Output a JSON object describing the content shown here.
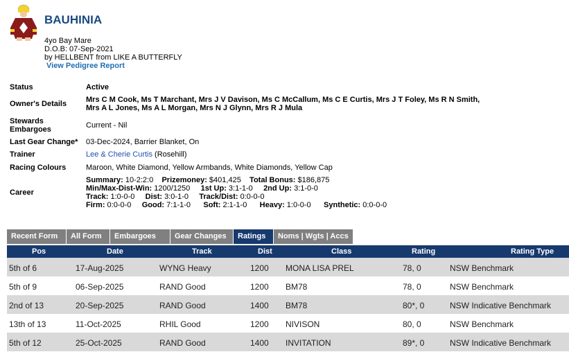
{
  "horse": {
    "name": "BAUHINIA",
    "description": "4yo Bay Mare",
    "dob": "D.O.B: 07-Sep-2021",
    "breeding": "by HELLBENT  from LIKE A BUTTERFLY",
    "pedigree_link": "View Pedigree Report"
  },
  "details": {
    "status_label": "Status",
    "status_value": "Active",
    "owners_label": "Owner's Details",
    "owners_value": "Mrs C M Cook, Ms T Marchant, Mrs J V Davison, Ms C McCallum, Ms C E Curtis, Mrs J T Foley, Ms R N Smith, Mrs A L Jones, Ms A L Morgan, Mrs N J Glynn, Mrs R J Mula",
    "stewards_label": "Stewards Embargoes",
    "stewards_value": "Current - Nil",
    "gear_label": "Last Gear Change*",
    "gear_value": "03-Dec-2024, Barrier Blanket, On",
    "trainer_label": "Trainer",
    "trainer_name": "Lee & Cherie Curtis",
    "trainer_location": " (Rosehill)",
    "colours_label": "Racing Colours",
    "colours_value": "Maroon, White Diamond, Yellow Armbands, White Diamonds, Yellow Cap",
    "career_label": "Career",
    "career": {
      "summary_label": "Summary:",
      "summary_value": " 10-2:2:0",
      "prizemoney_label": "Prizemoney:",
      "prizemoney_value": " $401,425",
      "bonus_label": "Total Bonus:",
      "bonus_value": " $186,875",
      "minmax_label": "Min/Max-Dist-Win:",
      "minmax_value": " 1200/1250",
      "firstup_label": "1st Up:",
      "firstup_value": " 3:1-1-0",
      "secondup_label": "2nd Up:",
      "secondup_value": " 3:1-0-0",
      "track_label": "Track:",
      "track_value": " 1:0-0-0",
      "dist_label": "Dist:",
      "dist_value": " 3:0-1-0",
      "trackdist_label": "Track/Dist:",
      "trackdist_value": " 0:0-0-0",
      "firm_label": "Firm:",
      "firm_value": " 0:0-0-0",
      "good_label": "Good:",
      "good_value": " 7:1-1-0",
      "soft_label": "Soft:",
      "soft_value": " 2:1-1-0",
      "heavy_label": "Heavy:",
      "heavy_value": " 1:0-0-0",
      "synthetic_label": "Synthetic:",
      "synthetic_value": " 0:0-0-0"
    }
  },
  "tabs": [
    {
      "label": "Recent Form",
      "active": false
    },
    {
      "label": "All Form",
      "active": false
    },
    {
      "label": "Embargoes",
      "active": false
    },
    {
      "label": "Gear Changes",
      "active": false
    },
    {
      "label": "Ratings",
      "active": true
    },
    {
      "label": "Noms | Wgts | Accs",
      "active": false
    }
  ],
  "table": {
    "headers": {
      "pos": "Pos",
      "date": "Date",
      "track": "Track",
      "dist": "Dist",
      "class": "Class",
      "rating": "Rating",
      "rating_type": "Rating Type"
    },
    "rows": [
      {
        "pos": "5th of 6",
        "date": "17-Aug-2025",
        "track": "WYNG Heavy",
        "dist": "1200",
        "class": "MONA LISA PREL",
        "rating": "78, 0",
        "rating_type": "NSW Benchmark"
      },
      {
        "pos": "5th of 9",
        "date": "06-Sep-2025",
        "track": "RAND Good",
        "dist": "1200",
        "class": "BM78",
        "rating": "78, 0",
        "rating_type": "NSW Benchmark"
      },
      {
        "pos": "2nd of 13",
        "date": "20-Sep-2025",
        "track": "RAND Good",
        "dist": "1400",
        "class": "BM78",
        "rating": "80*, 0",
        "rating_type": "NSW Indicative Benchmark"
      },
      {
        "pos": "13th of 13",
        "date": "11-Oct-2025",
        "track": "RHIL Good",
        "dist": "1200",
        "class": "NIVISON",
        "rating": "80, 0",
        "rating_type": "NSW Benchmark"
      },
      {
        "pos": "5th of 12",
        "date": "25-Oct-2025",
        "track": "RAND Good",
        "dist": "1400",
        "class": "INVITATION",
        "rating": "89*, 0",
        "rating_type": "NSW Indicative Benchmark"
      }
    ]
  },
  "colors": {
    "title": "#1a4a80",
    "header_bg": "#173a6e",
    "tab_bg": "#808080",
    "row_alt": "#d9d9d9",
    "silks_maroon": "#8b1a1a",
    "silks_yellow": "#f2d22e"
  }
}
